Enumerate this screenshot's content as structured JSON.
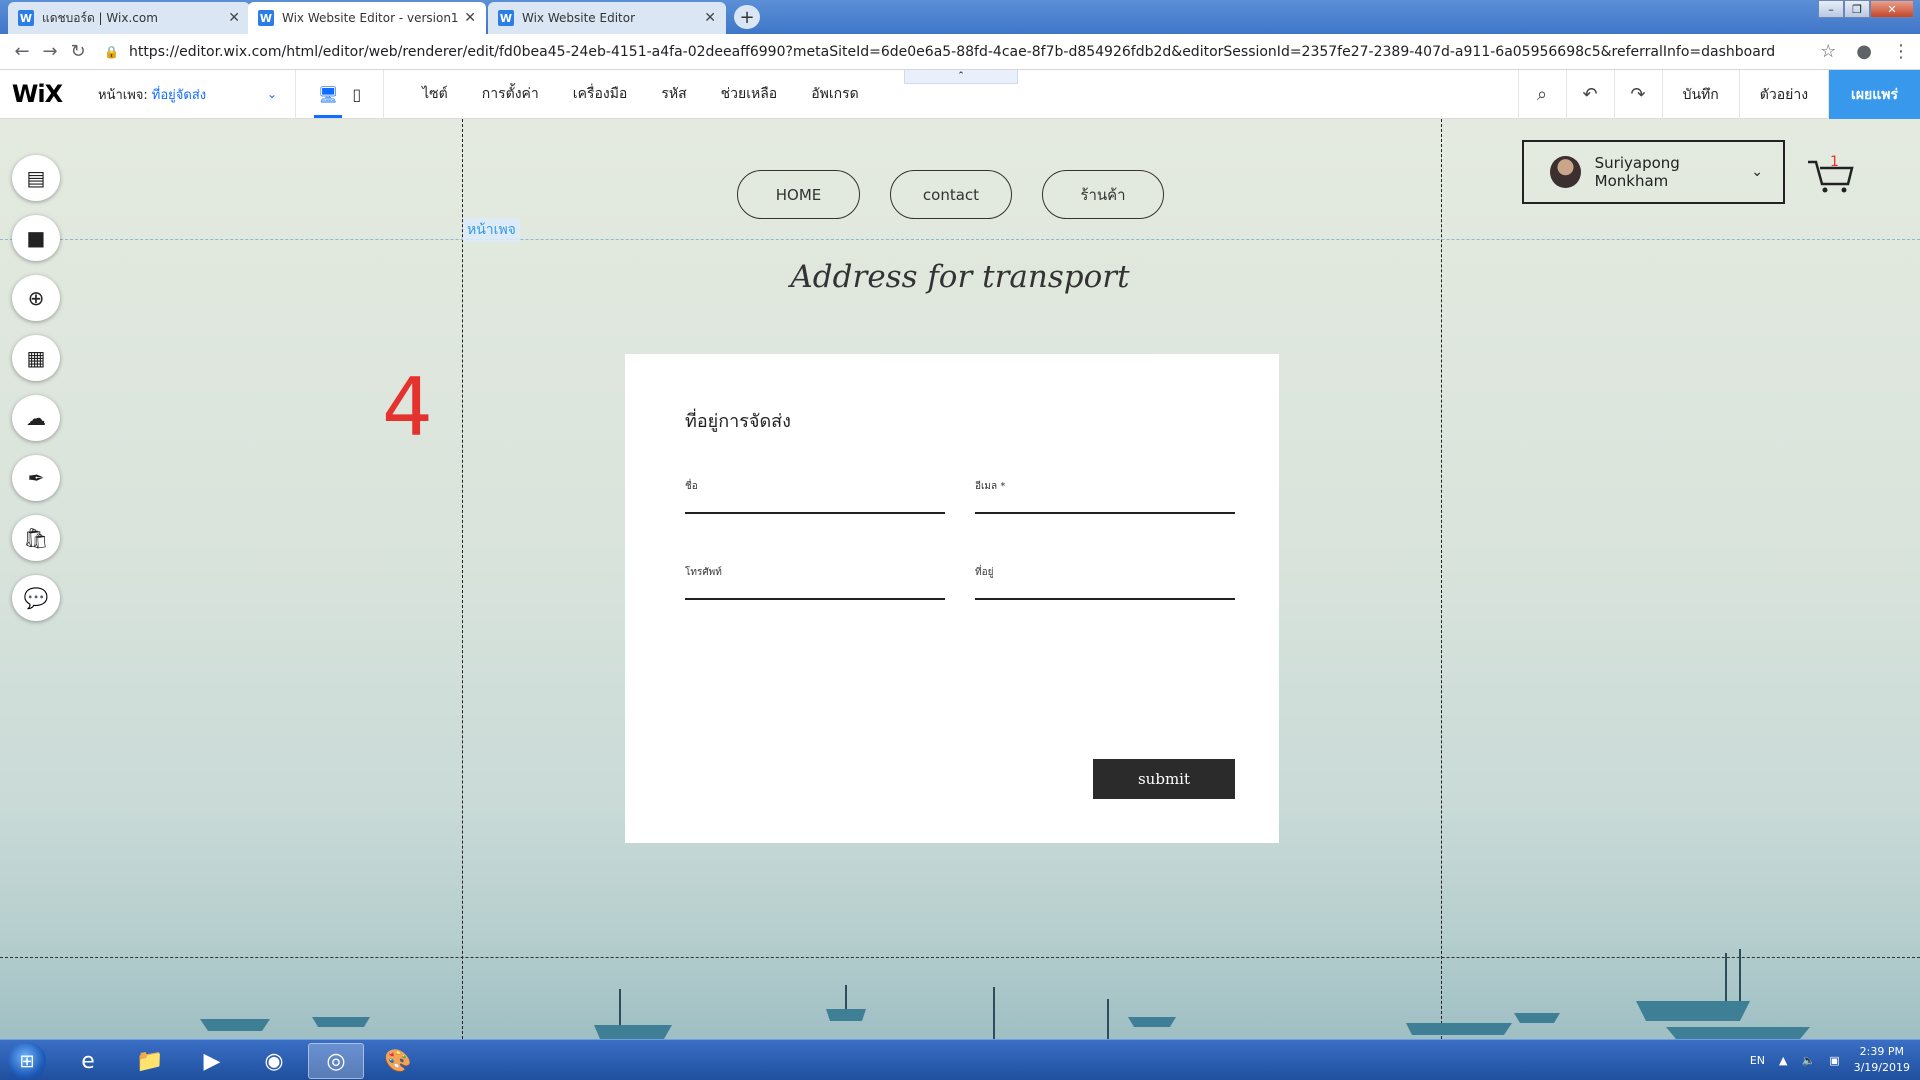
{
  "browser": {
    "tabs": [
      {
        "label": "แดชบอร์ด | Wix.com",
        "favicon": "wix-favicon"
      },
      {
        "label": "Wix Website Editor - version1",
        "favicon": "wix-favicon"
      },
      {
        "label": "Wix Website Editor",
        "favicon": "wix-favicon"
      }
    ],
    "url": "https://editor.wix.com/html/editor/web/renderer/edit/fd0bea45-24eb-4151-a4fa-02deeaff6990?metaSiteId=6de0e6a5-88fd-4cae-8f7b-d854926fdb2d&editorSessionId=2357fe27-2389-407d-a911-6a05956698c5&referralInfo=dashboard"
  },
  "editor": {
    "logo": "WiX",
    "page_label": "หน้าเพจ:",
    "page_name": "ที่อยู่จัดส่ง",
    "menu": [
      "ไซต์",
      "การตั้งค่า",
      "เครื่องมือ",
      "รหัส",
      "ช่วยเหลือ",
      "อัพเกรด"
    ],
    "save": "บันทึก",
    "preview": "ตัวอย่าง",
    "publish": "เผยแพร่"
  },
  "canvas": {
    "page_tag": "หน้าเพจ",
    "nav": [
      "HOME",
      "contact",
      "ร้านค้า"
    ],
    "user_name": "Suriyapong Monkham",
    "cart_count": "1",
    "annotation": "4",
    "headline": "Address for transport",
    "form": {
      "title": "ที่อยู่การจัดส่ง",
      "fields": [
        {
          "label": "ชื่อ"
        },
        {
          "label": "อีเมล *"
        },
        {
          "label": "โทรศัพท์"
        },
        {
          "label": "ที่อยู่"
        }
      ],
      "submit": "submit"
    }
  },
  "taskbar": {
    "lang": "EN",
    "time": "2:39 PM",
    "date": "3/19/2019"
  },
  "colors": {
    "wix_blue": "#116dff",
    "publish_blue": "#3899ec",
    "annotation_red": "#e5322f"
  }
}
